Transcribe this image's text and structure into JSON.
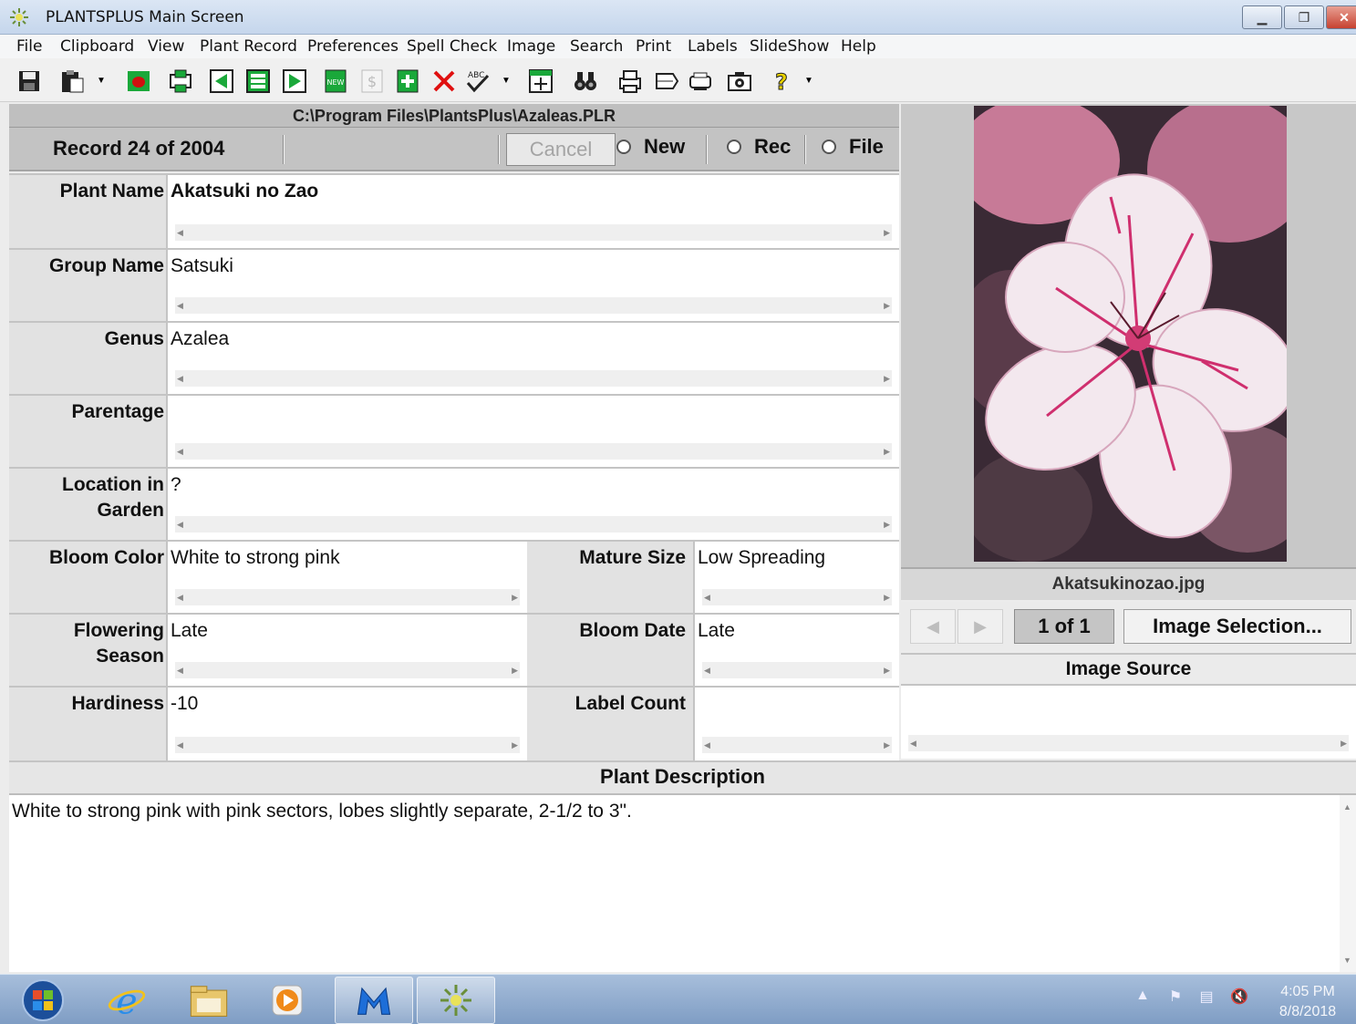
{
  "window": {
    "title": "PLANTSPLUS Main Screen"
  },
  "menu": [
    "File",
    "Clipboard",
    "View",
    "Plant Record",
    "Preferences",
    "Spell Check",
    "Image",
    "Search",
    "Print",
    "Labels",
    "SlideShow",
    "Help"
  ],
  "toolbar": {
    "icons": [
      "save-icon",
      "paste-icon",
      "open-icon",
      "print-preview-icon",
      "previous-record-icon",
      "list-icon",
      "next-record-icon",
      "new-record-icon",
      "price-icon",
      "add-record-icon",
      "delete-icon",
      "spell-check-icon",
      "fit-window-icon",
      "find-icon",
      "printer-icon",
      "label-icon",
      "label-printer-icon",
      "camera-icon",
      "help-icon"
    ]
  },
  "file_path": "C:\\Program Files\\PlantsPlus\\Azaleas.PLR",
  "record": {
    "position": "Record 24 of 2004",
    "cancel_label": "Cancel",
    "radio_new": "New",
    "radio_rec": "Rec",
    "radio_file": "File"
  },
  "fields": {
    "plant_name": {
      "label": "Plant Name",
      "value": "Akatsuki no Zao"
    },
    "group_name": {
      "label": "Group Name",
      "value": "Satsuki"
    },
    "genus": {
      "label": "Genus",
      "value": "Azalea"
    },
    "parentage": {
      "label": "Parentage",
      "value": ""
    },
    "location_line1": "Location in",
    "location_line2": "Garden",
    "location": {
      "value": "?"
    },
    "bloom_color": {
      "label": "Bloom Color",
      "value": "White to strong pink"
    },
    "mature_size": {
      "label": "Mature Size",
      "value": "Low Spreading"
    },
    "flowering_line1": "Flowering",
    "flowering_line2": "Season",
    "flowering_season": {
      "value": "Late"
    },
    "bloom_date": {
      "label": "Bloom Date",
      "value": "Late"
    },
    "hardiness": {
      "label": "Hardiness",
      "value": "-10"
    },
    "label_count": {
      "label": "Label Count",
      "value": ""
    }
  },
  "image": {
    "filename": "Akatsukinozao.jpg",
    "counter": "1 of 1",
    "selection_label": "Image Selection...",
    "source_header": "Image Source",
    "source_value": ""
  },
  "description": {
    "header": "Plant Description",
    "text": "White to strong pink with pink sectors, lobes slightly separate, 2-1/2 to 3\"."
  },
  "taskbar": {
    "apps": [
      "internet-explorer-icon",
      "file-explorer-icon",
      "media-player-icon",
      "malwarebytes-icon",
      "plantsplus-icon"
    ],
    "time": "4:05 PM",
    "date": "8/8/2018"
  },
  "colors": {
    "titlebar": "#c5d6ec",
    "panel": "#c3c3c3",
    "taskbar": "#7f9dc4",
    "delete": "#e01010",
    "green_icon": "#1aa83a"
  }
}
